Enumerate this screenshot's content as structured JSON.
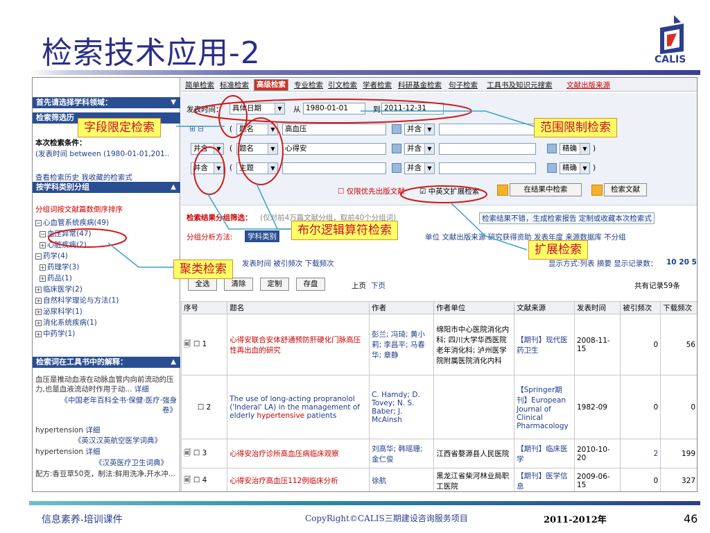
{
  "slide": {
    "title": "检索技术应用-2",
    "logo_text": "CALIS",
    "footer_left": "信息素养-培训课件",
    "footer_mid": "CopyRight©CALIS三期建设咨询服务项目",
    "footer_year": "2011-2012年",
    "page_number": "46"
  },
  "callouts": {
    "field": "字段限定检索",
    "range": "范围限制检索",
    "bool": "布尔逻辑算符检索",
    "ext": "扩展检索",
    "cluster": "聚类检索"
  },
  "sidebar": {
    "h1": "首先请选择学科领域：",
    "h2": "检索筛选历",
    "current_label": "本次检索条件：",
    "current_value": "(发表时间  between (1980-01-01,201..",
    "history_link": "查看检索历史  我收藏的检索式",
    "h3": "按学科类别分组",
    "group_note": "分组词按文献篇数倒序排序",
    "tree": [
      "心血管系统疾病(49)",
      "血压异常(47)",
      "心脏疾病(2)",
      "药学(4)",
      "药理学(3)",
      "药品(1)",
      "临床医学(2)",
      "自然科学理论与方法(1)",
      "泌尿科学(1)",
      "消化系统疾病(1)",
      "中药学(1)"
    ],
    "h4": "检索词在工具书中的解释：",
    "def1": "血压是推动血液在动脉血管内向前流动的压力,也是血液流动时作用于动...",
    "def1_link": "详细",
    "def1_src": "《中国老年百科全书·保健·医疗·强身卷》",
    "def2": "hypertension",
    "def2_link": "详细",
    "def2_src": "《英汉汉英航空医学词典》",
    "def3": "hypertension",
    "def3_link": "详细",
    "def3_src": "《汉英医疗卫生词典》",
    "def4": "配方:香豆草50克，制法:鲜用洗净,开水冲..."
  },
  "tabs": [
    "简单检索",
    "标准检索",
    "高级检索",
    "专业检索",
    "引文检索",
    "学者检索",
    "科研基金检索",
    "句子检索",
    "工具书及知识元搜索",
    "文献出版来源"
  ],
  "search": {
    "time_label": "发表时间：",
    "time_mode": "具体日期",
    "from_label": "从",
    "from_date": "1980-01-01",
    "to_label": "到",
    "to_date": "2011-12-31",
    "rows": [
      {
        "logic": "",
        "field": "题名",
        "value": "高血压",
        "op": "并含"
      },
      {
        "logic": "并含",
        "field": "题名",
        "value": "心得安",
        "op": "并含",
        "match": "精确"
      },
      {
        "logic": "并含",
        "field": "主题",
        "value": "",
        "op": "并含",
        "match": "精确"
      }
    ],
    "priority": "仅限优先出版文献",
    "extend": "中英文扩展检索",
    "in_results": "在结果中检索",
    "search_btn": "检索文献"
  },
  "grouping": {
    "filter_label": "检索结果分组筛选：",
    "filter_note": "(仅对前4万篇文献分组，取前40个分组词)",
    "note_right": "检索结果不错，生成检索报告    定制或收藏本次检索式",
    "method_label": "分组分析方法:",
    "method_btn": "学科类别",
    "methods": "单位  文献出版来源  研究获得资助  发表年度  来源数据库  不分组"
  },
  "toolbar": {
    "sort": "发表时间  被引频次  下载频次",
    "display": "显示方式:列表  摘要  显示记录数：",
    "page_sizes": "10  20  50",
    "select_all": "全选",
    "clear": "清除",
    "custom": "定制",
    "save": "存盘",
    "prev": "上页",
    "next": "下页",
    "total": "共有记录59条"
  },
  "table": {
    "headers": [
      "序号",
      "题名",
      "作者",
      "作者单位",
      "文献来源",
      "发表时间",
      "被引频次",
      "下载频次"
    ],
    "rows": [
      {
        "no": "1",
        "title_pre": "心得安",
        "title_rest": "联合安体舒通预防肝硬化门脉高压性再出血的研究",
        "author": "彭兰; 冯琦; 黄小莉; 李昌平; 马春华; 章静",
        "unit": "绵阳市中心医院消化内科; 四川大学华西医院老年消化科; 泸州医学院附属医院消化内科",
        "source": "【期刊】现代医药卫生",
        "date": "2008-11-15",
        "cited": "0",
        "dl": "56"
      },
      {
        "no": "2",
        "title_pre": "The use of long-acting propranolol ('Inderal' LA) in the management of elderly ",
        "title_hl": "hypertensive",
        "title_rest": " patients",
        "author": "C. Hamdy; D. Tovey; N. S. Baber; J. McAinsh",
        "unit": "",
        "source": "【Springer期刊】European Journal of Clinical Pharmacology",
        "date": "1982-09",
        "cited": "0",
        "dl": "0"
      },
      {
        "no": "3",
        "title_pre": "心得安",
        "title_mid": "治疗诊所",
        "title_hl": "高血压",
        "title_rest": "病临床观察",
        "author": "刘高华; 韩瑶珊; 金仁俊",
        "unit": "江西省婺源县人民医院",
        "source": "【期刊】临床医学",
        "date": "2010-10-20",
        "cited": "2",
        "dl": "199"
      },
      {
        "no": "4",
        "title_pre": "心得安",
        "title_mid": "治疗",
        "title_hl": "高血压",
        "title_rest": "112例临床分析",
        "author": "徐航",
        "unit": "黑龙江省柴河林业局职工医院",
        "source": "【期刊】医学信息",
        "date": "2009-06-15",
        "cited": "0",
        "dl": "327"
      }
    ]
  },
  "colors": {
    "title": "#2a2e87",
    "header_bar": "#2a4e92",
    "callout_bg": "#ffff66",
    "callout_text": "#c8102e",
    "link_red": "#c00"
  }
}
